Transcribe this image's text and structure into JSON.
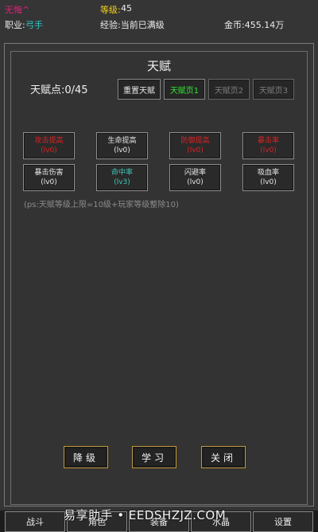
{
  "stats": {
    "name": "无悔^",
    "level_label": "等级:",
    "level_value": "45",
    "class_label": "职业:",
    "class_value": "弓手",
    "exp_text": "经验:当前已满级",
    "gold_text": "金币:455.14万"
  },
  "panel": {
    "title": "天赋",
    "points": "天赋点:0/45",
    "reset_label": "重置天赋",
    "pages": [
      "天赋页1",
      "天赋页2",
      "天赋页3"
    ]
  },
  "talents": [
    {
      "name": "攻击提高",
      "level": "(lv0)",
      "style": "red"
    },
    {
      "name": "生命提高",
      "level": "(lv0)",
      "style": "normal"
    },
    {
      "name": "防御提高",
      "level": "(lv0)",
      "style": "red"
    },
    {
      "name": "暴击率",
      "level": "(lv0)",
      "style": "red"
    },
    {
      "name": "暴击伤害",
      "level": "(lv0)",
      "style": "normal"
    },
    {
      "name": "命中率",
      "level": "(lv3)",
      "style": "teal"
    },
    {
      "name": "闪避率",
      "level": "(lv0)",
      "style": "normal"
    },
    {
      "name": "吸血率",
      "level": "(lv0)",
      "style": "normal"
    }
  ],
  "note": "(ps:天赋等级上限=10级+玩家等级整除10)",
  "actions": {
    "downgrade": "降级",
    "learn": "学习",
    "close": "关闭"
  },
  "tabs": [
    "战斗",
    "角色",
    "装备",
    "水晶",
    "设置"
  ],
  "watermark": "易享助手 • EEDSHZJZ.COM",
  "colors": {
    "name": "#e0207a",
    "level": "#f0d020",
    "class": "#2ec8c8",
    "active_page": "#33e233",
    "locked_talent": "#d82424",
    "learned_talent": "#3ec8b8",
    "action_border": "#b89a4a"
  }
}
